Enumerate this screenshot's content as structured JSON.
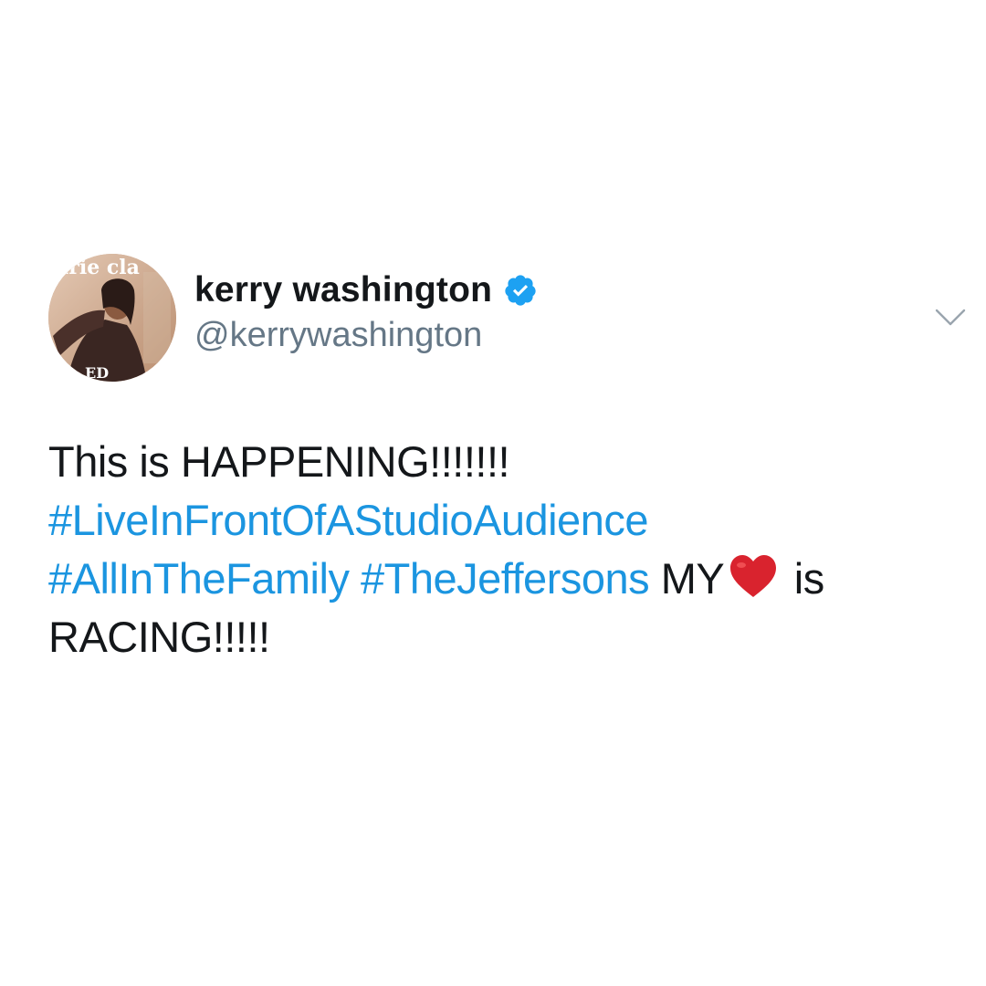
{
  "user": {
    "display_name": "kerry washington",
    "handle": "@kerrywashington",
    "avatar_cover_text": "arie cla",
    "avatar_bottom_text": "ED"
  },
  "icons": {
    "verified": "verified-badge-icon",
    "menu": "chevron-down-icon",
    "emoji": "red-heart-emoji"
  },
  "colors": {
    "hashtag": "#1b95e0",
    "verified": "#1da1f2",
    "text": "#14171a",
    "handle": "#657786",
    "heart": "#d9232e"
  },
  "tweet": {
    "line1": "This is HAPPENING!!!!!!!",
    "hashtag1": "#LiveInFrontOfAStudioAudience",
    "hashtag2": "#AllInTheFamily",
    "hashtag3": "#TheJeffersons",
    "text_before_emoji": "MY",
    "text_after_emoji": "is",
    "line4": "RACING!!!!!"
  }
}
